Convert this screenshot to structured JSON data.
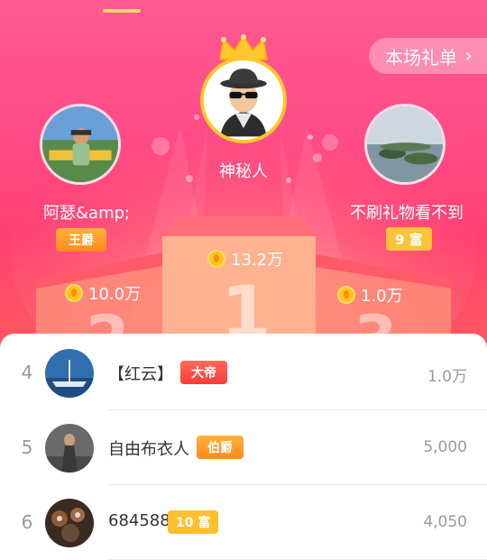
{
  "gift_list_button": {
    "label": "本场礼单",
    "chevron": "›"
  },
  "podium": {
    "first": {
      "name": "神秘人",
      "score": "13.2万",
      "rank_numeral": "1"
    },
    "second": {
      "name": "阿瑟&amp;",
      "badge": "王爵",
      "score": "10.0万",
      "rank_numeral": "2"
    },
    "third": {
      "name": "不刷礼物看不到",
      "badge": "9 富",
      "score": "1.0万",
      "rank_numeral": "3"
    }
  },
  "ranking": [
    {
      "rank": "4",
      "name": "【红云】",
      "badge": "大帝",
      "score": "1.0万"
    },
    {
      "rank": "5",
      "name": "自由布衣人",
      "badge": "伯爵",
      "score": "5,000"
    },
    {
      "rank": "6",
      "name": "684588",
      "badge": "10 富",
      "score": "4,050"
    }
  ],
  "colors": {
    "accent_pink": "#ff4d88",
    "gold": "#ffc23a",
    "coin": "#ffc51a"
  },
  "icons": [
    "crown-icon",
    "coin-icon",
    "chevron-right-icon"
  ]
}
